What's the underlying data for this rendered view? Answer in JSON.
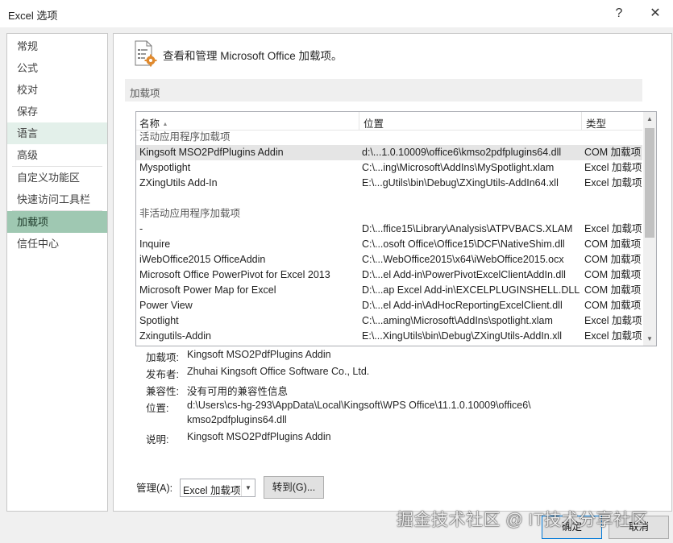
{
  "window": {
    "title": "Excel 选项",
    "help_glyph": "?",
    "close_glyph": "✕"
  },
  "sidebar": {
    "items": [
      {
        "label": "常规"
      },
      {
        "label": "公式"
      },
      {
        "label": "校对"
      },
      {
        "label": "保存"
      },
      {
        "label": "语言"
      },
      {
        "label": "高级"
      },
      {
        "label": "自定义功能区"
      },
      {
        "label": "快速访问工具栏"
      },
      {
        "label": "加载项"
      },
      {
        "label": "信任中心"
      }
    ],
    "selected": "加载项",
    "hovered": "语言"
  },
  "header": {
    "text": "查看和管理 Microsoft Office 加载项。",
    "icon": "addins-gear-icon"
  },
  "section": {
    "title": "加载项"
  },
  "table": {
    "columns": [
      "名称",
      "位置",
      "类型"
    ],
    "sort_glyph": "▲",
    "active_group": "活动应用程序加载项",
    "active_rows": [
      {
        "name": "Kingsoft MSO2PdfPlugins Addin",
        "location": "d:\\...1.0.10009\\office6\\kmso2pdfplugins64.dll",
        "type": "COM 加载项"
      },
      {
        "name": "Myspotlight",
        "location": "C:\\...ing\\Microsoft\\AddIns\\MySpotlight.xlam",
        "type": "Excel 加载项"
      },
      {
        "name": "ZXingUtils Add-In",
        "location": "E:\\...gUtils\\bin\\Debug\\ZXingUtils-AddIn64.xll",
        "type": "Excel 加载项"
      }
    ],
    "inactive_group": "非活动应用程序加载项",
    "inactive_rows": [
      {
        "name": "-",
        "location": "D:\\...ffice15\\Library\\Analysis\\ATPVBACS.XLAM",
        "type": "Excel 加载项"
      },
      {
        "name": "Inquire",
        "location": "C:\\...osoft Office\\Office15\\DCF\\NativeShim.dll",
        "type": "COM 加载项"
      },
      {
        "name": "iWebOffice2015 OfficeAddin",
        "location": "C:\\...WebOffice2015\\x64\\iWebOffice2015.ocx",
        "type": "COM 加载项"
      },
      {
        "name": "Microsoft Office PowerPivot for Excel 2013",
        "location": "D:\\...el Add-in\\PowerPivotExcelClientAddIn.dll",
        "type": "COM 加载项"
      },
      {
        "name": "Microsoft Power Map for Excel",
        "location": "D:\\...ap Excel Add-in\\EXCELPLUGINSHELL.DLL",
        "type": "COM 加载项"
      },
      {
        "name": "Power View",
        "location": "D:\\...el Add-in\\AdHocReportingExcelClient.dll",
        "type": "COM 加载项"
      },
      {
        "name": "Spotlight",
        "location": "C:\\...aming\\Microsoft\\AddIns\\spotlight.xlam",
        "type": "Excel 加载项"
      },
      {
        "name": "Zxingutils-Addin",
        "location": "E:\\...XingUtils\\bin\\Debug\\ZXingUtils-AddIn.xll",
        "type": "Excel 加载项"
      }
    ]
  },
  "details": {
    "addin_label": "加载项:",
    "addin_value": "Kingsoft MSO2PdfPlugins Addin",
    "publisher_label": "发布者:",
    "publisher_value": "Zhuhai Kingsoft Office Software Co., Ltd.",
    "compat_label": "兼容性:",
    "compat_value": "没有可用的兼容性信息",
    "location_label": "位置:",
    "location_value_1": "d:\\Users\\cs-hg-293\\AppData\\Local\\Kingsoft\\WPS Office\\11.1.0.10009\\office6\\",
    "location_value_2": "kmso2pdfplugins64.dll",
    "desc_label": "说明:",
    "desc_value": "Kingsoft MSO2PdfPlugins Addin"
  },
  "manage": {
    "label": "管理(A):",
    "select_value": "Excel 加载项",
    "goto_label": "转到(G)..."
  },
  "buttons": {
    "ok": "确定",
    "cancel": "取消"
  },
  "watermark": "掘金技术社区 @ IT技术分享社区"
}
